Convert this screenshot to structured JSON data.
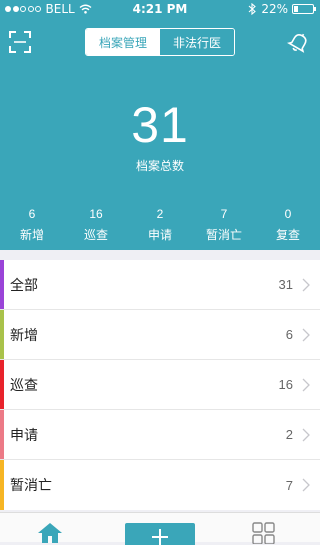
{
  "status_bar": {
    "carrier": "BELL",
    "time": "4:21 PM",
    "battery_text": "22%",
    "battery_level": 0.22
  },
  "header": {
    "tabs": [
      {
        "label": "档案管理",
        "active": false
      },
      {
        "label": "非法行医",
        "active": true
      }
    ],
    "total": "31",
    "total_label": "档案总数",
    "stats": [
      {
        "value": "6",
        "label": "新增"
      },
      {
        "value": "16",
        "label": "巡查"
      },
      {
        "value": "2",
        "label": "申请"
      },
      {
        "value": "7",
        "label": "暂消亡"
      },
      {
        "value": "0",
        "label": "复查"
      }
    ]
  },
  "list": {
    "rows": [
      {
        "label": "全部",
        "count": "31",
        "color": "#9a44d8"
      },
      {
        "label": "新增",
        "count": "6",
        "color": "#a9c24a"
      },
      {
        "label": "巡查",
        "count": "16",
        "color": "#e8232b"
      },
      {
        "label": "申请",
        "count": "2",
        "color": "#ec7a86"
      },
      {
        "label": "暂消亡",
        "count": "7",
        "color": "#f6b524"
      }
    ]
  },
  "icons": {
    "scan": "scan-icon",
    "bell": "bell-icon",
    "home": "home-icon",
    "add": "plus-icon",
    "apps": "grid-icon"
  },
  "colors": {
    "accent": "#3aa6b9",
    "background": "#efeff4"
  }
}
